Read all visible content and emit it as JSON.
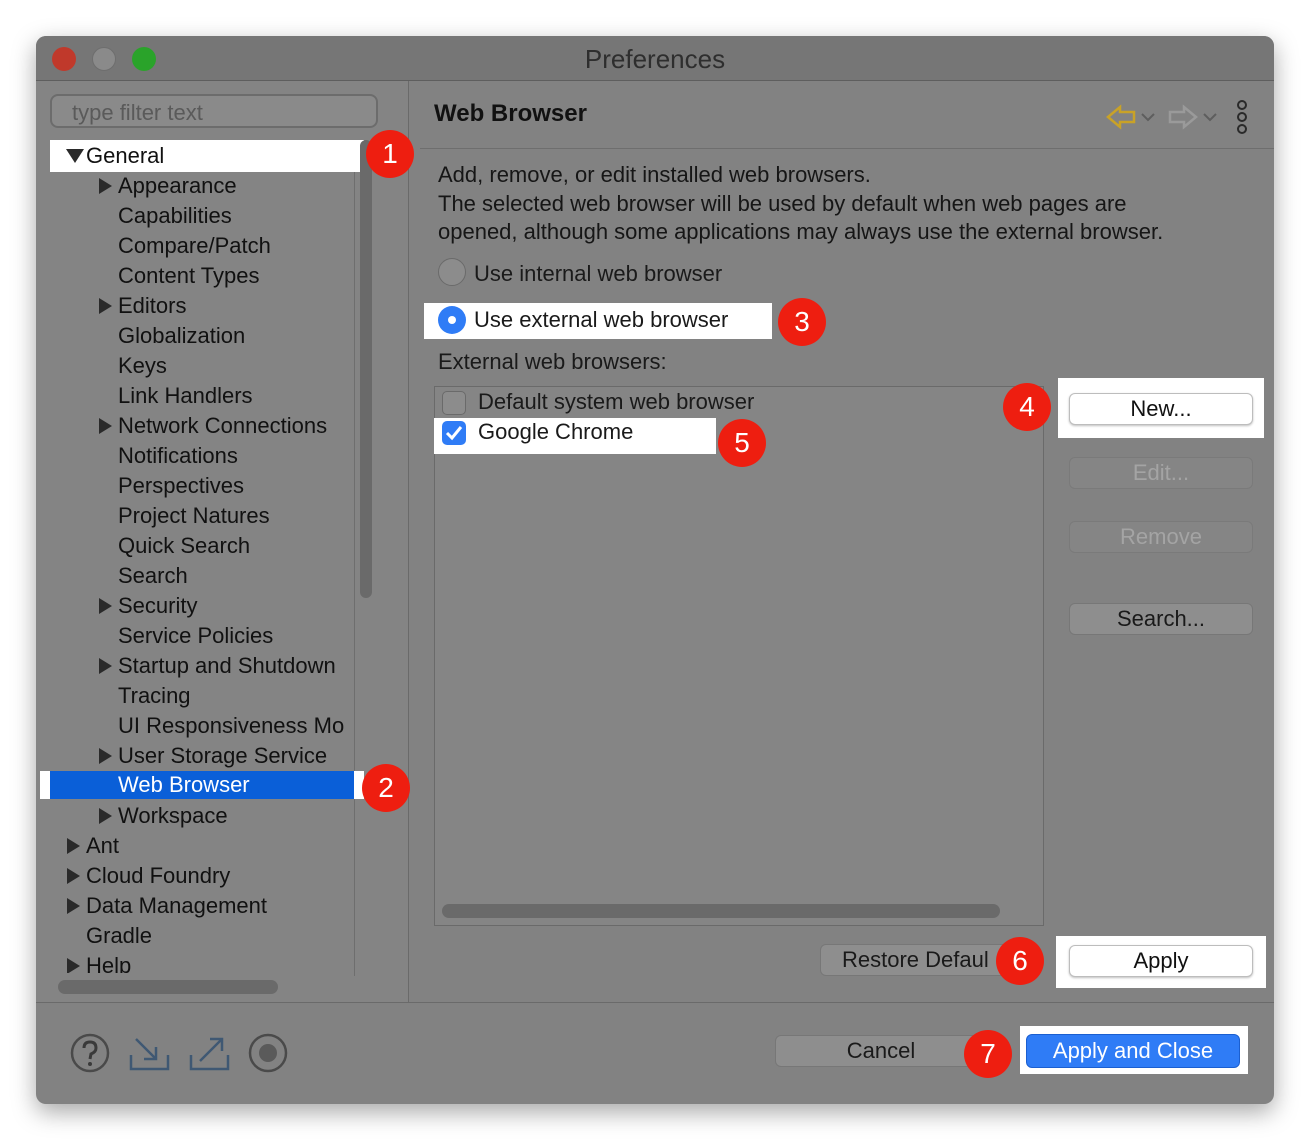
{
  "window": {
    "title": "Preferences"
  },
  "filter": {
    "placeholder": "type filter text"
  },
  "tree": {
    "general": "General",
    "general_children": [
      "Appearance",
      "Capabilities",
      "Compare/Patch",
      "Content Types",
      "Editors",
      "Globalization",
      "Keys",
      "Link Handlers",
      "Network Connections",
      "Notifications",
      "Perspectives",
      "Project Natures",
      "Quick Search",
      "Search",
      "Security",
      "Service Policies",
      "Startup and Shutdown",
      "Tracing",
      "UI Responsiveness Mo",
      "User Storage Service",
      "Web Browser",
      "Workspace"
    ],
    "top_level": [
      "Ant",
      "Cloud Foundry",
      "Data Management",
      "Gradle",
      "Help"
    ],
    "selected": "Web Browser"
  },
  "page": {
    "title": "Web Browser",
    "description_lines": [
      "Add, remove, or edit installed web browsers.",
      "The selected web browser will be used by default when web pages are",
      "opened, although some applications may always use the external browser."
    ],
    "radio_internal": "Use internal web browser",
    "radio_external": "Use external web browser",
    "radio_selected": "external",
    "list_label": "External web browsers:",
    "browsers": [
      {
        "name": "Default system web browser",
        "checked": false
      },
      {
        "name": "Google Chrome",
        "checked": true
      }
    ],
    "buttons": {
      "new": "New...",
      "edit": "Edit...",
      "remove": "Remove",
      "search": "Search..."
    },
    "restore_defaults": "Restore Defaul",
    "apply": "Apply"
  },
  "footer": {
    "cancel": "Cancel",
    "apply_close": "Apply and Close"
  },
  "badges": [
    "1",
    "2",
    "3",
    "4",
    "5",
    "6",
    "7"
  ],
  "icons": [
    "help-icon",
    "import-icon",
    "export-icon",
    "record-icon",
    "back-arrow-icon",
    "forward-arrow-icon",
    "view-menu-icon"
  ],
  "colors": {
    "selection": "#0a5fd8",
    "badge": "#ee1e10",
    "primary_button": "#2f7cf6",
    "window_bg": "#828282"
  }
}
